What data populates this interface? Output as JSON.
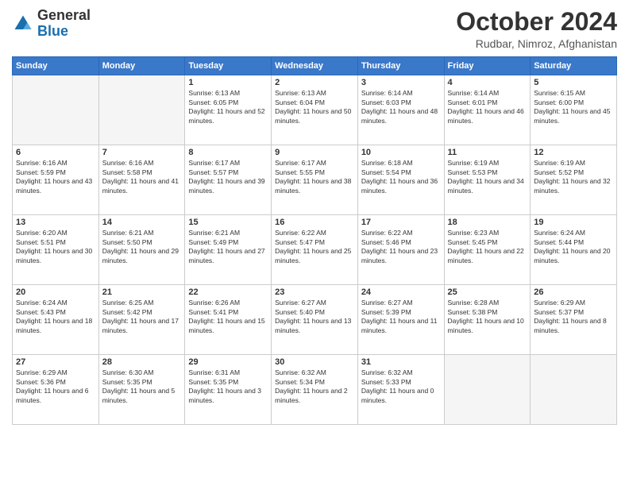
{
  "header": {
    "logo": {
      "general": "General",
      "blue": "Blue"
    },
    "title": "October 2024",
    "location": "Rudbar, Nimroz, Afghanistan"
  },
  "weekdays": [
    "Sunday",
    "Monday",
    "Tuesday",
    "Wednesday",
    "Thursday",
    "Friday",
    "Saturday"
  ],
  "weeks": [
    [
      {
        "day": "",
        "sunrise": "",
        "sunset": "",
        "daylight": "",
        "empty": true
      },
      {
        "day": "",
        "sunrise": "",
        "sunset": "",
        "daylight": "",
        "empty": true
      },
      {
        "day": "1",
        "sunrise": "Sunrise: 6:13 AM",
        "sunset": "Sunset: 6:05 PM",
        "daylight": "Daylight: 11 hours and 52 minutes."
      },
      {
        "day": "2",
        "sunrise": "Sunrise: 6:13 AM",
        "sunset": "Sunset: 6:04 PM",
        "daylight": "Daylight: 11 hours and 50 minutes."
      },
      {
        "day": "3",
        "sunrise": "Sunrise: 6:14 AM",
        "sunset": "Sunset: 6:03 PM",
        "daylight": "Daylight: 11 hours and 48 minutes."
      },
      {
        "day": "4",
        "sunrise": "Sunrise: 6:14 AM",
        "sunset": "Sunset: 6:01 PM",
        "daylight": "Daylight: 11 hours and 46 minutes."
      },
      {
        "day": "5",
        "sunrise": "Sunrise: 6:15 AM",
        "sunset": "Sunset: 6:00 PM",
        "daylight": "Daylight: 11 hours and 45 minutes."
      }
    ],
    [
      {
        "day": "6",
        "sunrise": "Sunrise: 6:16 AM",
        "sunset": "Sunset: 5:59 PM",
        "daylight": "Daylight: 11 hours and 43 minutes."
      },
      {
        "day": "7",
        "sunrise": "Sunrise: 6:16 AM",
        "sunset": "Sunset: 5:58 PM",
        "daylight": "Daylight: 11 hours and 41 minutes."
      },
      {
        "day": "8",
        "sunrise": "Sunrise: 6:17 AM",
        "sunset": "Sunset: 5:57 PM",
        "daylight": "Daylight: 11 hours and 39 minutes."
      },
      {
        "day": "9",
        "sunrise": "Sunrise: 6:17 AM",
        "sunset": "Sunset: 5:55 PM",
        "daylight": "Daylight: 11 hours and 38 minutes."
      },
      {
        "day": "10",
        "sunrise": "Sunrise: 6:18 AM",
        "sunset": "Sunset: 5:54 PM",
        "daylight": "Daylight: 11 hours and 36 minutes."
      },
      {
        "day": "11",
        "sunrise": "Sunrise: 6:19 AM",
        "sunset": "Sunset: 5:53 PM",
        "daylight": "Daylight: 11 hours and 34 minutes."
      },
      {
        "day": "12",
        "sunrise": "Sunrise: 6:19 AM",
        "sunset": "Sunset: 5:52 PM",
        "daylight": "Daylight: 11 hours and 32 minutes."
      }
    ],
    [
      {
        "day": "13",
        "sunrise": "Sunrise: 6:20 AM",
        "sunset": "Sunset: 5:51 PM",
        "daylight": "Daylight: 11 hours and 30 minutes."
      },
      {
        "day": "14",
        "sunrise": "Sunrise: 6:21 AM",
        "sunset": "Sunset: 5:50 PM",
        "daylight": "Daylight: 11 hours and 29 minutes."
      },
      {
        "day": "15",
        "sunrise": "Sunrise: 6:21 AM",
        "sunset": "Sunset: 5:49 PM",
        "daylight": "Daylight: 11 hours and 27 minutes."
      },
      {
        "day": "16",
        "sunrise": "Sunrise: 6:22 AM",
        "sunset": "Sunset: 5:47 PM",
        "daylight": "Daylight: 11 hours and 25 minutes."
      },
      {
        "day": "17",
        "sunrise": "Sunrise: 6:22 AM",
        "sunset": "Sunset: 5:46 PM",
        "daylight": "Daylight: 11 hours and 23 minutes."
      },
      {
        "day": "18",
        "sunrise": "Sunrise: 6:23 AM",
        "sunset": "Sunset: 5:45 PM",
        "daylight": "Daylight: 11 hours and 22 minutes."
      },
      {
        "day": "19",
        "sunrise": "Sunrise: 6:24 AM",
        "sunset": "Sunset: 5:44 PM",
        "daylight": "Daylight: 11 hours and 20 minutes."
      }
    ],
    [
      {
        "day": "20",
        "sunrise": "Sunrise: 6:24 AM",
        "sunset": "Sunset: 5:43 PM",
        "daylight": "Daylight: 11 hours and 18 minutes."
      },
      {
        "day": "21",
        "sunrise": "Sunrise: 6:25 AM",
        "sunset": "Sunset: 5:42 PM",
        "daylight": "Daylight: 11 hours and 17 minutes."
      },
      {
        "day": "22",
        "sunrise": "Sunrise: 6:26 AM",
        "sunset": "Sunset: 5:41 PM",
        "daylight": "Daylight: 11 hours and 15 minutes."
      },
      {
        "day": "23",
        "sunrise": "Sunrise: 6:27 AM",
        "sunset": "Sunset: 5:40 PM",
        "daylight": "Daylight: 11 hours and 13 minutes."
      },
      {
        "day": "24",
        "sunrise": "Sunrise: 6:27 AM",
        "sunset": "Sunset: 5:39 PM",
        "daylight": "Daylight: 11 hours and 11 minutes."
      },
      {
        "day": "25",
        "sunrise": "Sunrise: 6:28 AM",
        "sunset": "Sunset: 5:38 PM",
        "daylight": "Daylight: 11 hours and 10 minutes."
      },
      {
        "day": "26",
        "sunrise": "Sunrise: 6:29 AM",
        "sunset": "Sunset: 5:37 PM",
        "daylight": "Daylight: 11 hours and 8 minutes."
      }
    ],
    [
      {
        "day": "27",
        "sunrise": "Sunrise: 6:29 AM",
        "sunset": "Sunset: 5:36 PM",
        "daylight": "Daylight: 11 hours and 6 minutes."
      },
      {
        "day": "28",
        "sunrise": "Sunrise: 6:30 AM",
        "sunset": "Sunset: 5:35 PM",
        "daylight": "Daylight: 11 hours and 5 minutes."
      },
      {
        "day": "29",
        "sunrise": "Sunrise: 6:31 AM",
        "sunset": "Sunset: 5:35 PM",
        "daylight": "Daylight: 11 hours and 3 minutes."
      },
      {
        "day": "30",
        "sunrise": "Sunrise: 6:32 AM",
        "sunset": "Sunset: 5:34 PM",
        "daylight": "Daylight: 11 hours and 2 minutes."
      },
      {
        "day": "31",
        "sunrise": "Sunrise: 6:32 AM",
        "sunset": "Sunset: 5:33 PM",
        "daylight": "Daylight: 11 hours and 0 minutes."
      },
      {
        "day": "",
        "sunrise": "",
        "sunset": "",
        "daylight": "",
        "empty": true
      },
      {
        "day": "",
        "sunrise": "",
        "sunset": "",
        "daylight": "",
        "empty": true
      }
    ]
  ]
}
